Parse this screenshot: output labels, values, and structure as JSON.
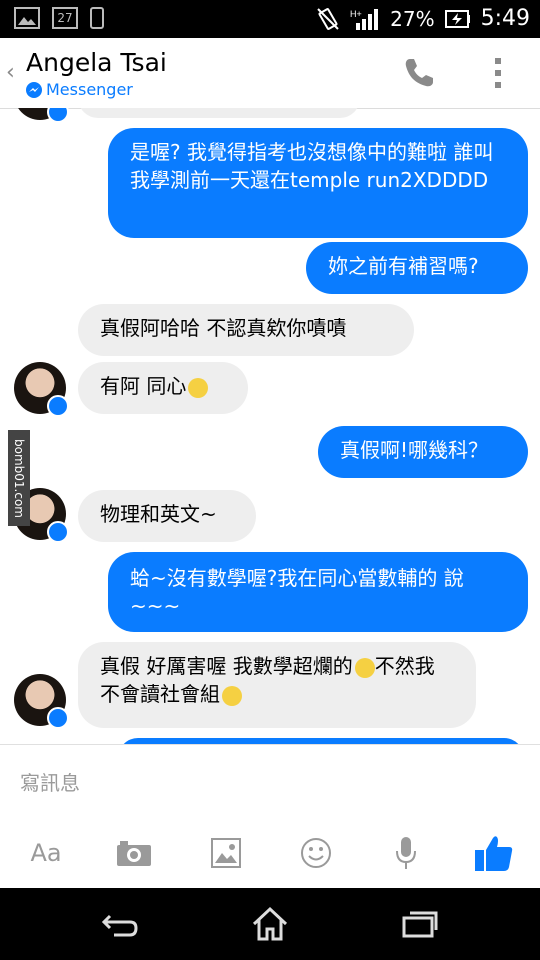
{
  "status": {
    "notif_count": "27",
    "battery": "27%",
    "time": "5:49"
  },
  "header": {
    "back_label": "‹",
    "contact_name": "Angela Tsai",
    "app_label": "Messenger"
  },
  "messages": [
    {
      "side": "out",
      "text": "是喔? 我覺得指考也沒想像中的難啦 誰叫我學測前一天還在temple run2XDDDD"
    },
    {
      "side": "out",
      "text": "妳之前有補習嗎?"
    },
    {
      "side": "in",
      "text": "真假阿哈哈 不認真欸你嘖嘖"
    },
    {
      "side": "in",
      "text": "有阿 同心",
      "emoji": "grin"
    },
    {
      "side": "out",
      "text": "真假啊!哪幾科？"
    },
    {
      "side": "in",
      "text": "物理和英文~"
    },
    {
      "side": "out",
      "text": "蛤~沒有數學喔?我在同心當數輔的 說~~~"
    },
    {
      "side": "in",
      "text": "真假 好厲害喔 我數學超爛的",
      "text2": "不然我不會讀社會組"
    }
  ],
  "watermark": "bomb01.com",
  "composer": {
    "placeholder": "寫訊息",
    "aa_label": "Aa"
  },
  "colors": {
    "accent": "#0a7cff",
    "incoming": "#eeeeee"
  },
  "icons": [
    "phone-icon",
    "overflow-menu-icon",
    "camera-icon",
    "gallery-icon",
    "emoji-icon",
    "microphone-icon",
    "thumbs-up-icon",
    "back-nav-icon",
    "home-nav-icon",
    "recents-nav-icon"
  ]
}
